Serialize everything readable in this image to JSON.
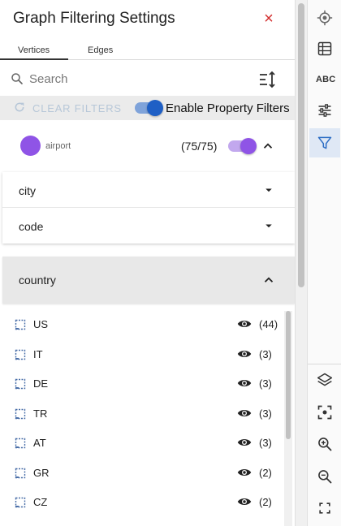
{
  "panel": {
    "title": "Graph Filtering Settings",
    "close_label": "×"
  },
  "tabs": [
    {
      "label": "Vertices",
      "active": true
    },
    {
      "label": "Edges",
      "active": false
    }
  ],
  "search": {
    "placeholder": "Search",
    "value": ""
  },
  "filter_bar": {
    "clear_label": "CLEAR FILTERS",
    "clear_enabled": false,
    "property_filters_label": "Enable Property Filters",
    "property_filters_enabled": true
  },
  "vertex_type": {
    "name": "airport",
    "count": "(75/75)",
    "color": "#8f54e6",
    "enabled": true,
    "expanded": true
  },
  "properties": [
    {
      "name": "city",
      "expanded": false
    },
    {
      "name": "code",
      "expanded": false
    }
  ],
  "country": {
    "name": "country",
    "expanded": true,
    "values": [
      {
        "name": "US",
        "count": "(44)",
        "visible": true
      },
      {
        "name": "IT",
        "count": "(3)",
        "visible": true
      },
      {
        "name": "DE",
        "count": "(3)",
        "visible": true
      },
      {
        "name": "TR",
        "count": "(3)",
        "visible": true
      },
      {
        "name": "AT",
        "count": "(3)",
        "visible": true
      },
      {
        "name": "GR",
        "count": "(2)",
        "visible": true
      },
      {
        "name": "CZ",
        "count": "(2)",
        "visible": true
      }
    ]
  },
  "sidebar_tools": {
    "top": [
      "target-icon",
      "table-icon",
      "abc-icon",
      "sliders-icon",
      "filter-icon"
    ],
    "bottom": [
      "layers-icon",
      "focus-icon",
      "zoom-in-icon",
      "zoom-out-icon",
      "fullscreen-icon"
    ],
    "abc_label": "ABC",
    "active": "filter-icon"
  },
  "colors": {
    "accent_blue": "#1e5fc5",
    "vertex_purple": "#8f54e6",
    "close_red": "#d32f2f"
  }
}
